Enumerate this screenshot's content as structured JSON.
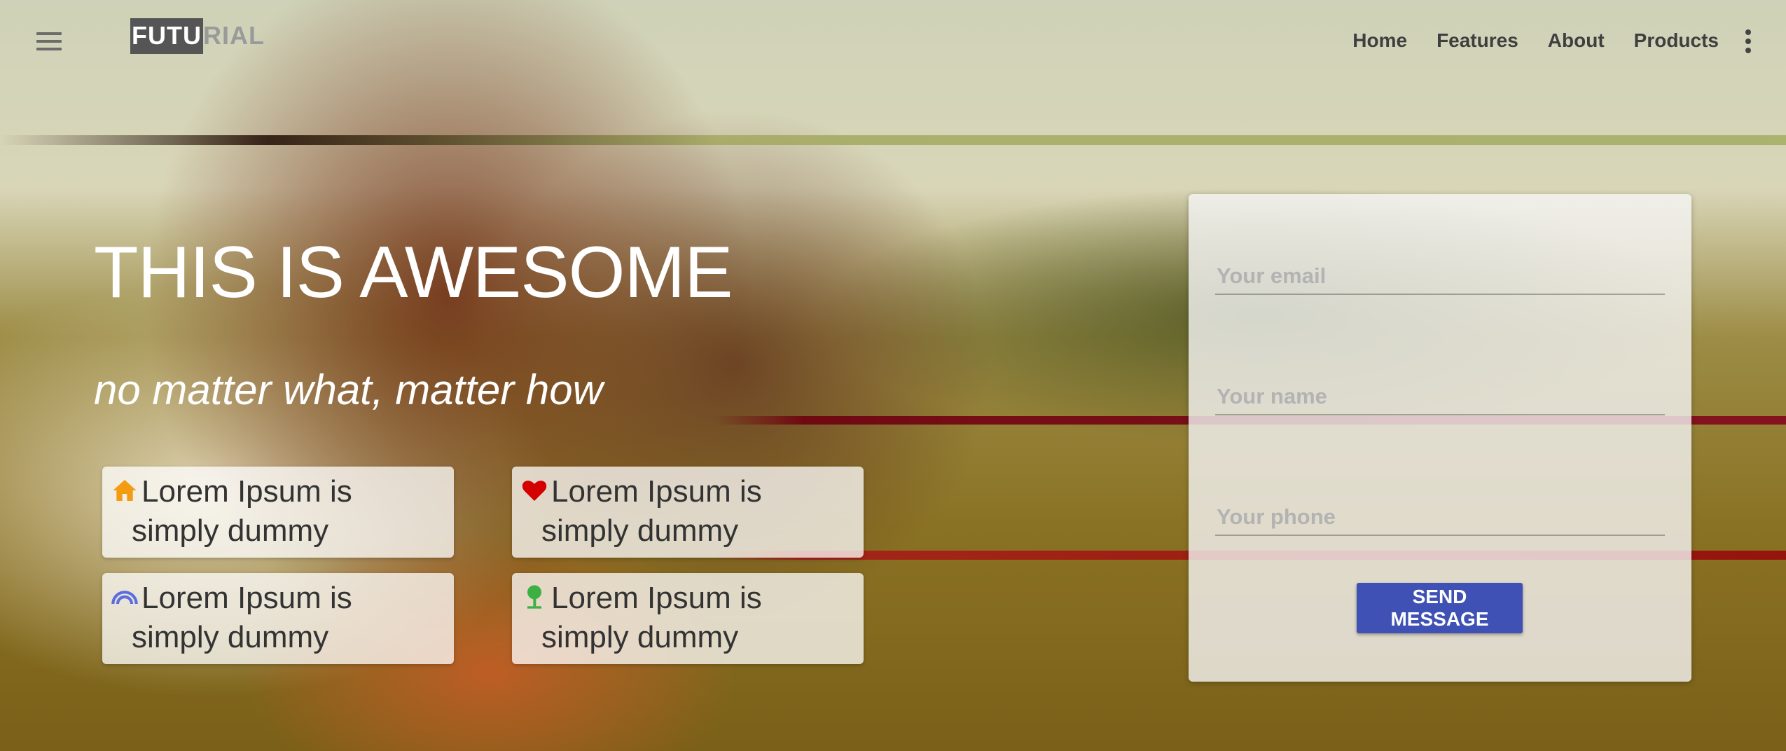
{
  "nav": {
    "logo_part1": "FUTU",
    "logo_part2": "RIAL",
    "menu": [
      "Home",
      "Features",
      "About",
      "Products"
    ],
    "menu_icon": "hamburger-icon",
    "more_icon": "more-vert-icon"
  },
  "hero": {
    "title": "THIS IS AWESOME",
    "subtitle": "no matter what, matter how"
  },
  "features": [
    {
      "icon": "home-icon",
      "icon_color": "#f39c12",
      "text": "Lorem Ipsum is simply dummy"
    },
    {
      "icon": "heart-icon",
      "icon_color": "#d40000",
      "text": "Lorem Ipsum is simply dummy"
    },
    {
      "icon": "rainbow-icon",
      "icon_color": "#5b6ee1",
      "text": "Lorem Ipsum is simply dummy"
    },
    {
      "icon": "tree-icon",
      "icon_color": "#3cb043",
      "text": "Lorem Ipsum is simply dummy"
    }
  ],
  "form": {
    "email_placeholder": "Your email",
    "name_placeholder": "Your name",
    "phone_placeholder": "Your phone",
    "submit_label": "SEND MESSAGE",
    "submit_color": "#3f51b5"
  }
}
